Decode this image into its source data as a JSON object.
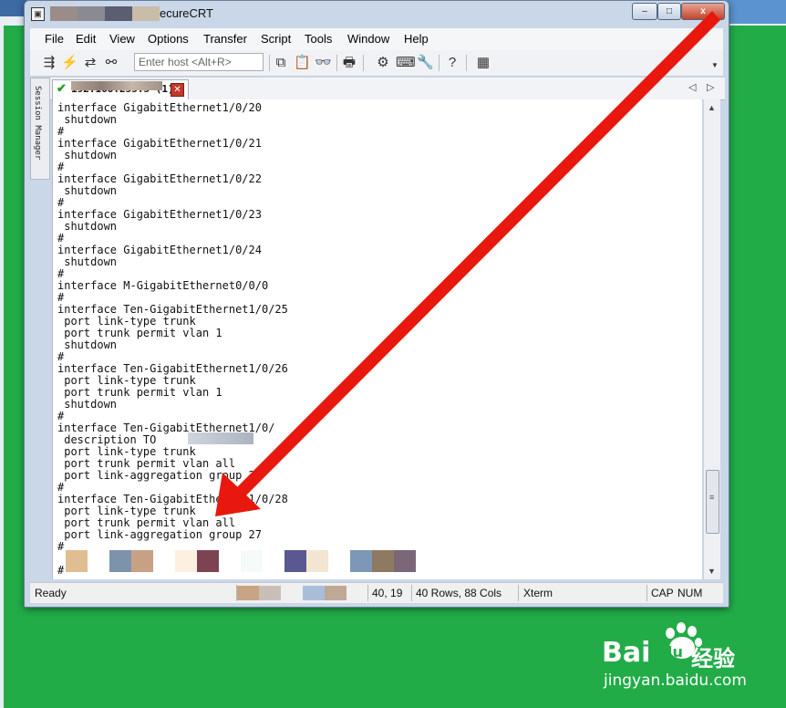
{
  "window": {
    "title": "ecureCRT",
    "controls": {
      "minimize": "–",
      "maximize": "□",
      "close": "x"
    }
  },
  "menu": [
    "File",
    "Edit",
    "View",
    "Options",
    "Transfer",
    "Script",
    "Tools",
    "Window",
    "Help"
  ],
  "toolbar": {
    "host_placeholder": "Enter host <Alt+R>",
    "icons": [
      "connect-icon",
      "quick-connect-icon",
      "reconnect-icon",
      "disconnect-icon",
      "copy-icon",
      "paste-icon",
      "find-icon",
      "print-icon",
      "settings-icon",
      "keymap-icon",
      "sftp-icon",
      "help-icon",
      "screenshot-icon"
    ]
  },
  "sidebar": {
    "label": "Session Manager"
  },
  "tab": {
    "label": "192.168.255.5 (1)"
  },
  "terminal": {
    "lines": [
      "interface GigabitEthernet1/0/20",
      " shutdown",
      "#",
      "interface GigabitEthernet1/0/21",
      " shutdown",
      "#",
      "interface GigabitEthernet1/0/22",
      " shutdown",
      "#",
      "interface GigabitEthernet1/0/23",
      " shutdown",
      "#",
      "interface GigabitEthernet1/0/24",
      " shutdown",
      "#",
      "interface M-GigabitEthernet0/0/0",
      "#",
      "interface Ten-GigabitEthernet1/0/25",
      " port link-type trunk",
      " port trunk permit vlan 1",
      " shutdown",
      "#",
      "interface Ten-GigabitEthernet1/0/26",
      " port link-type trunk",
      " port trunk permit vlan 1",
      " shutdown",
      "#",
      "interface Ten-GigabitEthernet1/0/",
      " description TO",
      " port link-type trunk",
      " port trunk permit vlan all",
      " port link-aggregation group 27",
      "#",
      "interface Ten-GigabitEthernet1/0/28",
      " port link-type trunk",
      " port trunk permit vlan all",
      " port link-aggregation group 27",
      "#",
      "",
      "#"
    ]
  },
  "status": {
    "ready": "Ready",
    "cursor": "40,  19",
    "size": "40 Rows, 88 Cols",
    "terminal_type": "Xterm",
    "cap": "CAP",
    "num": "NUM"
  },
  "watermark": {
    "brand": "Bai",
    "brand2": "du",
    "cn": "经验",
    "url": "jingyan.baidu.com"
  },
  "colors": {
    "desktop_green": "#22ac48",
    "arrow_red": "#e8180e",
    "close_red": "#c2452c"
  }
}
